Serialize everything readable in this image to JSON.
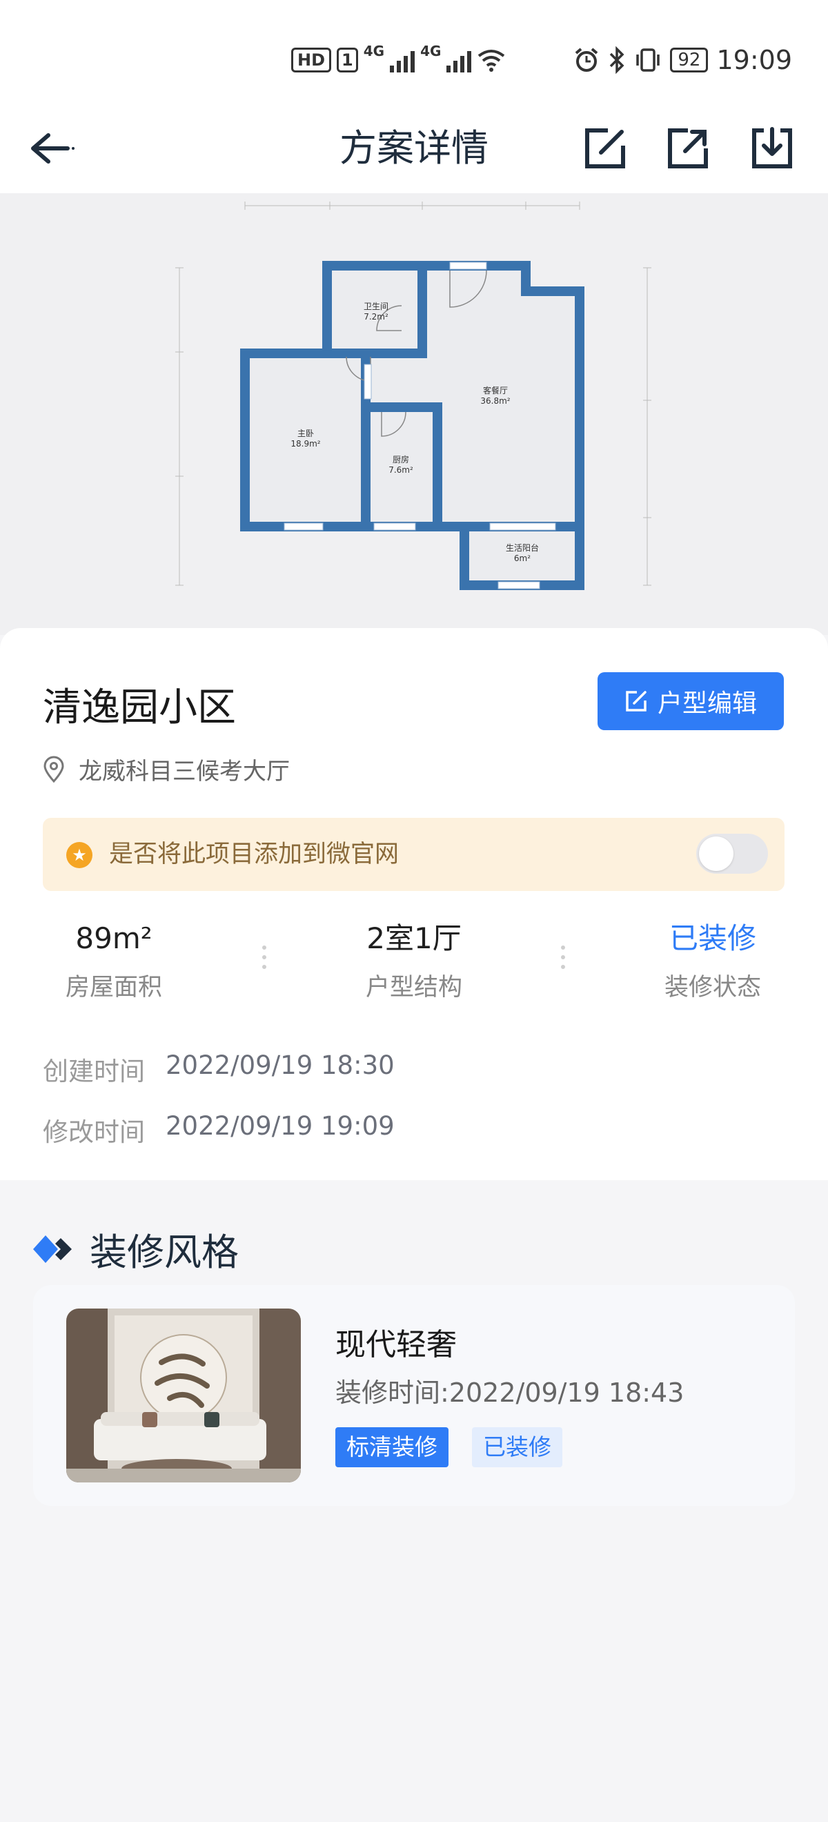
{
  "status_bar": {
    "hd": "HD",
    "sim": "1",
    "net1": "4G",
    "net2": "4G",
    "battery": "92",
    "time": "19:09"
  },
  "navbar": {
    "title": "方案详情",
    "icons": [
      "back-arrow-icon",
      "edit-icon",
      "share-icon",
      "download-icon"
    ]
  },
  "floorplan": {
    "rooms": [
      {
        "name": "卫生间",
        "area": "7.2m²"
      },
      {
        "name": "客餐厅",
        "area": "36.8m²"
      },
      {
        "name": "主卧",
        "area": "18.9m²"
      },
      {
        "name": "厨房",
        "area": "7.6m²"
      },
      {
        "name": "生活阳台",
        "area": "6m²"
      }
    ]
  },
  "project": {
    "name": "清逸园小区",
    "edit_button": "户型编辑",
    "location": "龙威科目三候考大厅",
    "notice": "是否将此项目添加到微官网",
    "toggle_on": false
  },
  "stats": [
    {
      "value": "89m²",
      "label": "房屋面积"
    },
    {
      "value": "2室1厅",
      "label": "户型结构"
    },
    {
      "value": "已装修",
      "label": "装修状态"
    }
  ],
  "times": {
    "created_label": "创建时间",
    "created_value": "2022/09/19 18:30",
    "modified_label": "修改时间",
    "modified_value": "2022/09/19 19:09"
  },
  "style_section": {
    "title": "装修风格",
    "item": {
      "name": "现代轻奢",
      "time": "装修时间:2022/09/19 18:43",
      "tag_primary": "标清装修",
      "tag_secondary": "已装修"
    }
  },
  "colors": {
    "accent": "#2f7cf6",
    "wall": "#3a73ad",
    "notice_bg": "#fdf1dd",
    "star": "#f5a524"
  }
}
